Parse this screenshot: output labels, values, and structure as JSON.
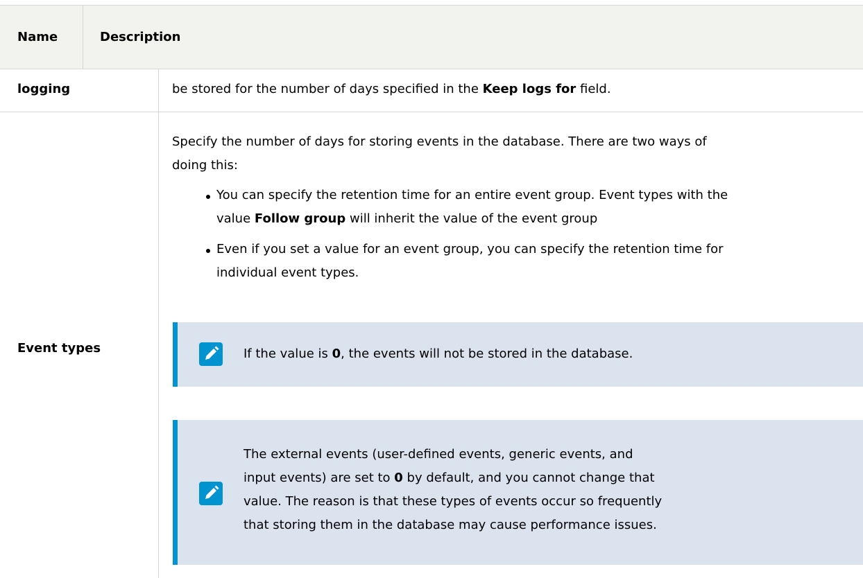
{
  "table": {
    "header": {
      "name": "Name",
      "description": "Description"
    },
    "row_logging": {
      "name": "logging",
      "text_before": "be stored for the number of days specified in the ",
      "text_bold": "Keep logs for",
      "text_after": " field."
    },
    "row_event_types": {
      "name": "Event types",
      "intro_line1": "Specify the number of days for storing events in the database. There are two ways of",
      "intro_line2": "doing this:",
      "bullet1_line1": "You can specify the retention time for an entire event group. Event types with the",
      "bullet1_line2_before": "value ",
      "bullet1_line2_bold": "Follow group",
      "bullet1_line2_after": " will inherit the value of the event group",
      "bullet2_line1": "Even if you set a value for an event group, you can specify the retention time for",
      "bullet2_line2": "individual event types.",
      "note1_before": "If the value is ",
      "note1_bold": "0",
      "note1_after": ", the events will not be stored in the database.",
      "note2_line1": "The external events (user-defined events, generic events, and",
      "note2_line2_before": "input events) are set to ",
      "note2_line2_bold": "0",
      "note2_line2_after": " by default, and you cannot change that",
      "note2_line3": "value. The reason is that these types of events occur so frequently",
      "note2_line4": "that storing them in the database may cause performance issues."
    }
  },
  "icons": {
    "note": "pencil-icon"
  },
  "colors": {
    "accent": "#0093d0",
    "note_bg": "#dbe3ef",
    "header_bg": "#f2f3ef"
  }
}
